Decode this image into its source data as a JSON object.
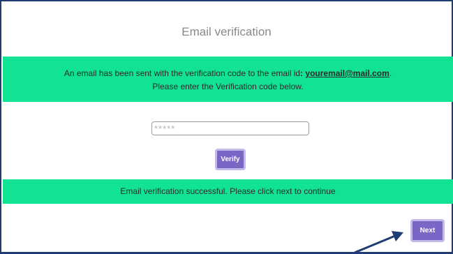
{
  "page": {
    "title": "Email verification"
  },
  "info_banner": {
    "line1_prefix": "An email has been sent with the verification code to the email id",
    "line1_colon": ":",
    "email": "youremail@mail.com",
    "line1_suffix": ".",
    "line2": "Please enter the Verification code below."
  },
  "code_input": {
    "placeholder": "*****",
    "value": ""
  },
  "verify_button": {
    "label": "Verify"
  },
  "success_banner": {
    "text": "Email verification successful. Please click next to continue"
  },
  "next_button": {
    "label": "Next"
  },
  "colors": {
    "banner_green": "#12e294",
    "button_purple": "#7a66c4",
    "frame_border": "#1f3d73",
    "arrow": "#1f3d73"
  },
  "annotation": {
    "icon": "arrow-icon",
    "target": "next_button"
  }
}
